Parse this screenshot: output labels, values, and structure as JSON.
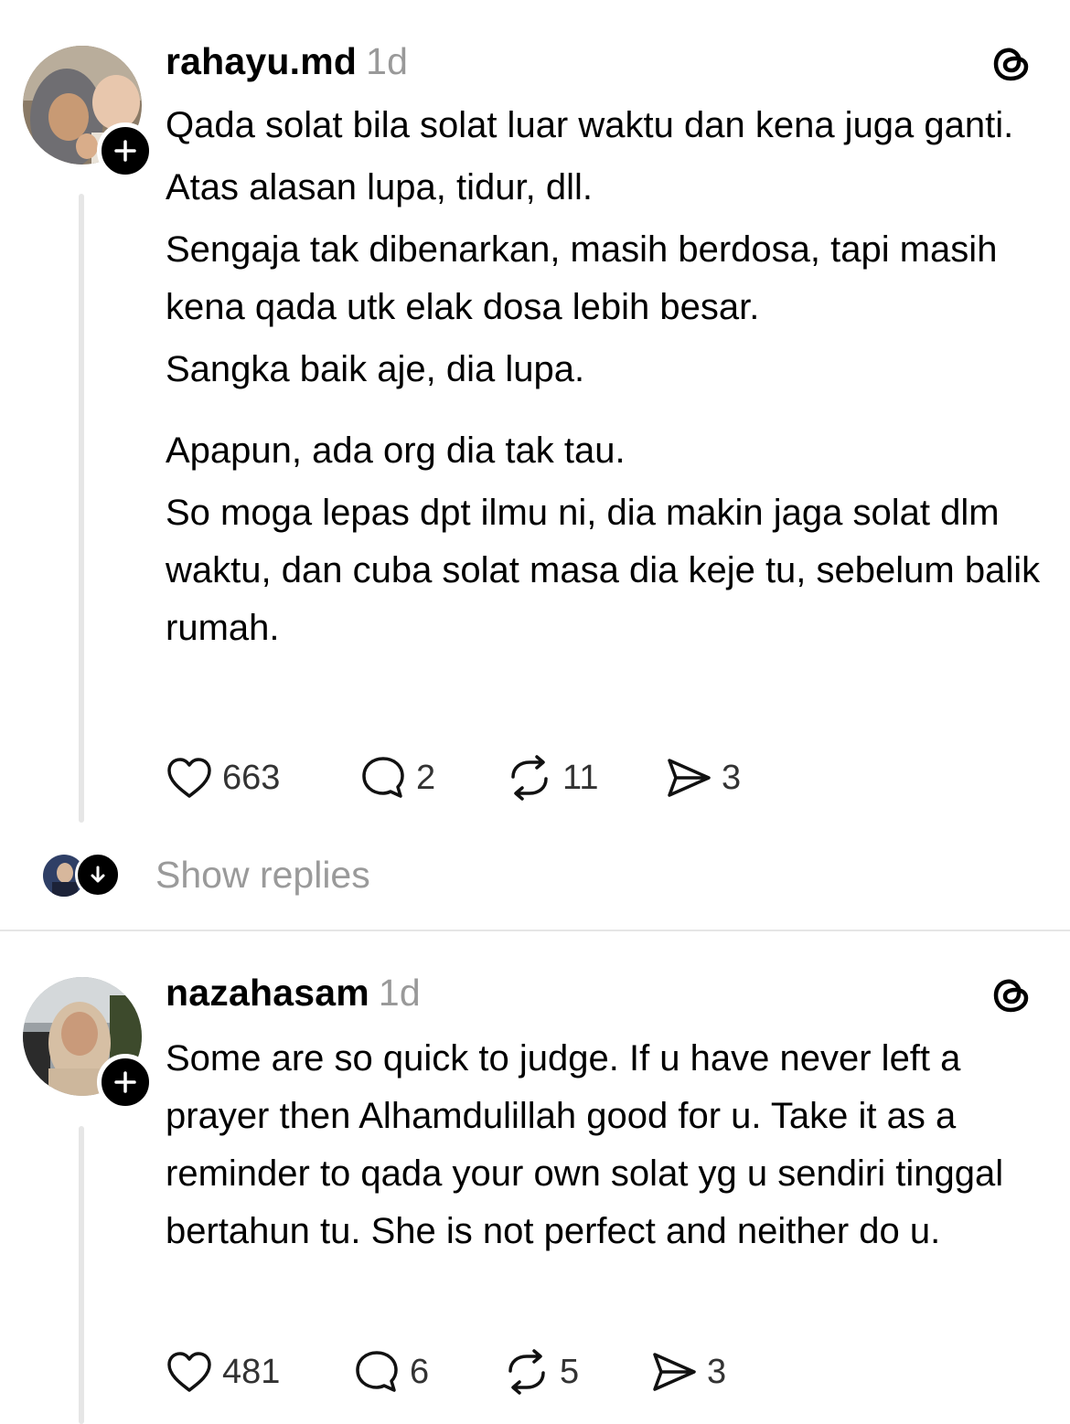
{
  "posts": [
    {
      "username": "rahayu.md",
      "time": "1d",
      "paragraphs": [
        "Qada solat bila solat luar waktu dan kena juga ganti.",
        "Atas alasan lupa, tidur, dll.",
        "Sengaja tak dibenarkan, masih berdosa, tapi masih kena qada utk elak dosa lebih besar.",
        "Sangka baik aje, dia lupa.",
        "Apapun, ada org dia tak tau.",
        "So moga lepas dpt ilmu ni, dia makin jaga solat dlm waktu, dan cuba solat masa dia keje tu, sebelum balik rumah."
      ],
      "likes": "663",
      "replies": "2",
      "reposts": "11",
      "shares": "3"
    },
    {
      "username": "nazahasam",
      "time": "1d",
      "paragraphs": [
        "Some are so quick to judge. If u have never left a prayer then Alhamdulillah good for u. Take it as a reminder to qada your own solat yg u sendiri tinggal bertahun tu. She is not perfect and neither do u."
      ],
      "likes": "481",
      "replies": "6",
      "reposts": "5",
      "shares": "3"
    }
  ],
  "show_replies_label": "Show replies",
  "icons": {
    "like": "heart-icon",
    "reply": "comment-icon",
    "repost": "repost-icon",
    "share": "send-icon",
    "follow": "plus-icon",
    "brand": "threads-logo-icon",
    "expand": "arrow-down-icon"
  }
}
